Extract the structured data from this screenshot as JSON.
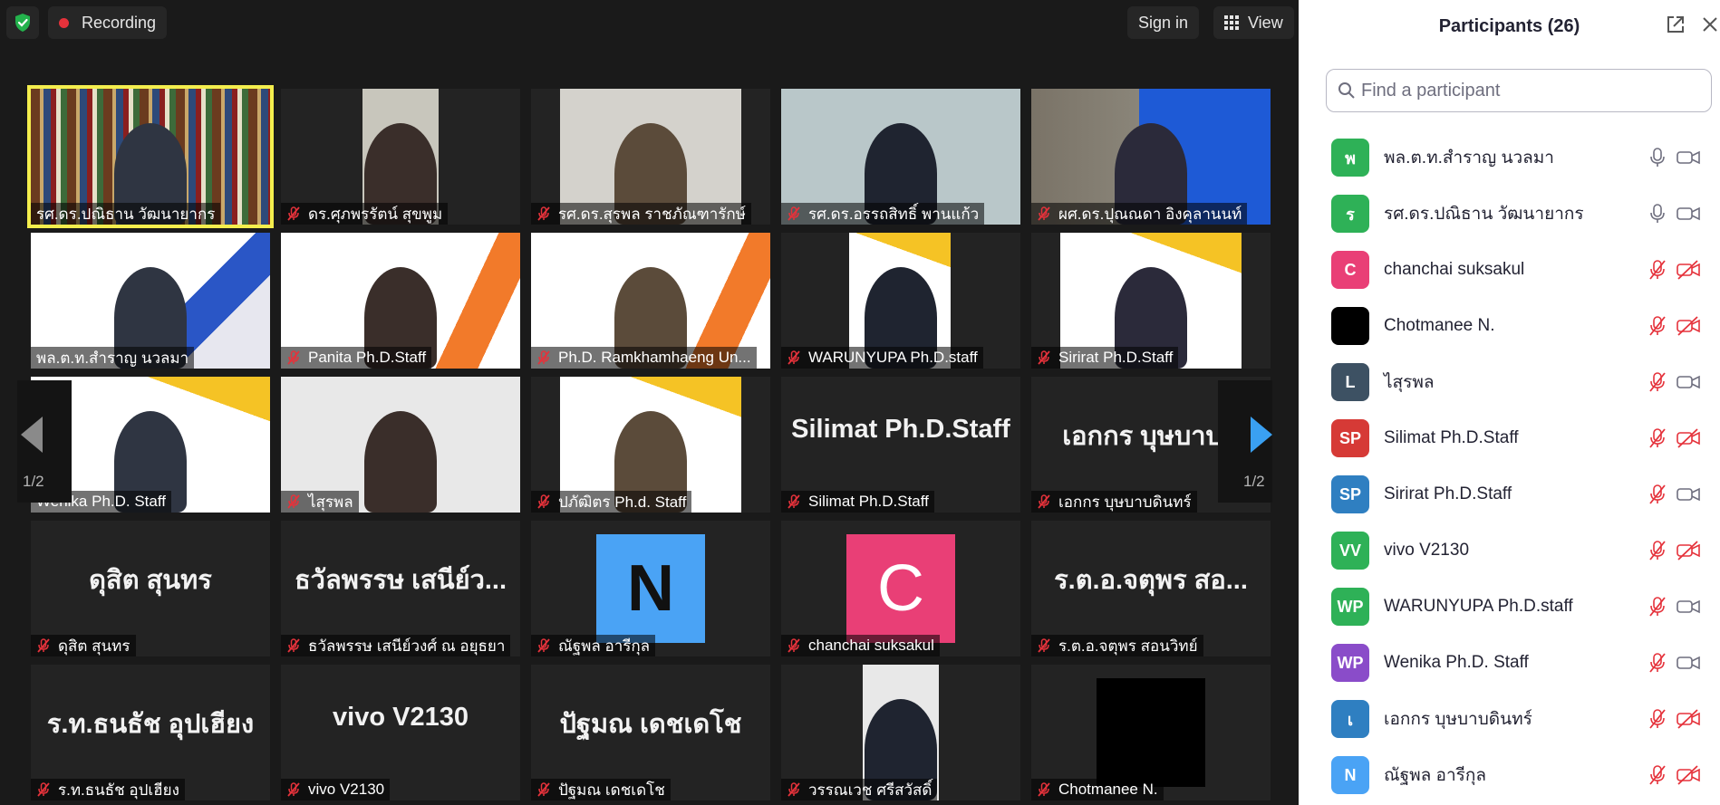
{
  "topbar": {
    "recording_label": "Recording",
    "signin_label": "Sign in",
    "view_label": "View"
  },
  "colors": {
    "speaking_outline": "#f4ee4d",
    "mute_red": "#e5323b",
    "accent_blue": "#3aa0f2"
  },
  "tiles": [
    {
      "label": "รศ.ดร.ปณิธาน วัฒนายากร",
      "muted": false,
      "speaking": true
    },
    {
      "label": "ดร.ศุภพรรัตน์ สุขพูม",
      "muted": true
    },
    {
      "label": "รศ.ดร.สุรพล ราชภัณฑารักษ์",
      "muted": true
    },
    {
      "label": "รศ.ดร.อรรถสิทธิ์ พานแก้ว",
      "muted": true
    },
    {
      "label": "ผศ.ดร.ปุณณดา อิงคุลานนท์",
      "muted": true
    },
    {
      "label": "พล.ต.ท.สำราญ นวลมา",
      "muted": false
    },
    {
      "label": "Panita Ph.D.Staff",
      "muted": true
    },
    {
      "label": "Ph.D. Ramkhamhaeng Un...",
      "muted": true
    },
    {
      "label": "WARUNYUPA Ph.D.staff",
      "muted": true
    },
    {
      "label": "Sirirat Ph.D.Staff",
      "muted": true
    },
    {
      "label": "Wenika Ph.D. Staff",
      "muted": false
    },
    {
      "label": "ไสุรพล",
      "muted": true
    },
    {
      "label": "ปภัฒิตร Ph.d. Staff",
      "muted": true
    },
    {
      "label": "Silimat Ph.D.Staff",
      "muted": true,
      "bigname": "Silimat Ph.D.Staff"
    },
    {
      "label": "เอกกร บุษบาบดินทร์",
      "muted": true,
      "bigname": "เอกกร บุษบาบดิ"
    },
    {
      "label": "ดุสิต สุนทร",
      "muted": true,
      "bigname": "ดุสิต สุนทร"
    },
    {
      "label": "ธวัลพรรษ เสนีย์วงศ์ ณ อยุธยา",
      "muted": true,
      "bigname": "ธวัลพรรษ เสนีย์ว..."
    },
    {
      "label": "ณัฐพล อารีกุล",
      "muted": true,
      "avatar": "N"
    },
    {
      "label": "chanchai suksakul",
      "muted": true,
      "avatar": "C"
    },
    {
      "label": "ร.ต.อ.จตุพร สอนวิทย์",
      "muted": true,
      "bigname": "ร.ต.อ.จตุพร สอ..."
    },
    {
      "label": "ร.ท.ธนธัช อุปเฮียง",
      "muted": true,
      "bigname": "ร.ท.ธนธัช อุปเฮียง"
    },
    {
      "label": "vivo V2130",
      "muted": true,
      "bigname": "vivo V2130"
    },
    {
      "label": "ปัฐมณ เดชเดโช",
      "muted": true,
      "bigname": "ปัฐมณ เดชเดโช"
    },
    {
      "label": "วรรณเวช ศรีสวัสดิ์",
      "muted": true
    },
    {
      "label": "Chotmanee N.",
      "muted": true
    }
  ],
  "pager": {
    "left_page": "1/2",
    "right_page": "1/2"
  },
  "panel": {
    "title": "Participants (26)",
    "search_placeholder": "Find a participant",
    "participants": [
      {
        "initial": "พ",
        "name": "พล.ต.ท.สำราญ นวลมา",
        "color": "#2eb157",
        "mic_on": true,
        "cam_on": true
      },
      {
        "initial": "ร",
        "name": "รศ.ดร.ปณิธาน วัฒนายากร",
        "color": "#2eb157",
        "mic_on": true,
        "cam_on": true
      },
      {
        "initial": "C",
        "name": "chanchai suksakul",
        "color": "#e93f76",
        "mic_on": false,
        "cam_on": false
      },
      {
        "initial": "",
        "name": "Chotmanee N.",
        "color": "#000000",
        "mic_on": false,
        "cam_on": false
      },
      {
        "initial": "L",
        "name": "ไสุรพล",
        "color": "#3d5163",
        "mic_on": false,
        "cam_on": true
      },
      {
        "initial": "SP",
        "name": "Silimat Ph.D.Staff",
        "color": "#d63a36",
        "mic_on": false,
        "cam_on": false
      },
      {
        "initial": "SP",
        "name": "Sirirat Ph.D.Staff",
        "color": "#2f7fc1",
        "mic_on": false,
        "cam_on": true
      },
      {
        "initial": "VV",
        "name": "vivo V2130",
        "color": "#2eb157",
        "mic_on": false,
        "cam_on": false
      },
      {
        "initial": "WP",
        "name": "WARUNYUPA Ph.D.staff",
        "color": "#2eb157",
        "mic_on": false,
        "cam_on": true
      },
      {
        "initial": "WP",
        "name": "Wenika Ph.D. Staff",
        "color": "#8a4cc9",
        "mic_on": false,
        "cam_on": true
      },
      {
        "initial": "เ",
        "name": "เอกกร บุษบาบดินทร์",
        "color": "#2f7fc1",
        "mic_on": false,
        "cam_on": false
      },
      {
        "initial": "N",
        "name": "ณัฐพล อารีกุล",
        "color": "#4aa3f5",
        "mic_on": false,
        "cam_on": false
      }
    ]
  }
}
